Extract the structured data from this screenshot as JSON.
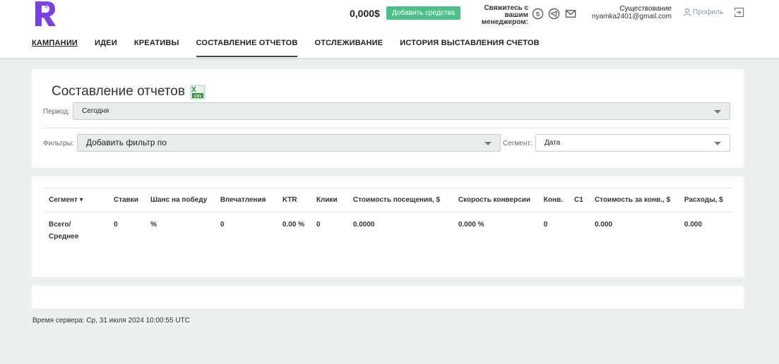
{
  "header": {
    "balance": "0,000$",
    "add_funds_label": "Добавить средства",
    "contact_label": "Свяжитесь с вашим менеджером:",
    "contact_icons": [
      "skype-icon",
      "telegram-icon",
      "mail-icon"
    ],
    "user_name": "Существование",
    "user_email": "nyamka2401@gmail.com",
    "profile_label": "Профиль"
  },
  "nav": {
    "items": [
      "КАМПАНИИ",
      "ИДЕИ",
      "КРЕАТИВЫ",
      "СОСТАВЛЕНИЕ ОТЧЕТОВ",
      "ОТСЛЕЖИВАНИЕ",
      "ИСТОРИЯ ВЫСТАВЛЕНИЯ СЧЕТОВ"
    ],
    "active": "СОСТАВЛЕНИЕ ОТЧЕТОВ",
    "underlined": "КАМПАНИИ"
  },
  "report": {
    "title": "Составление отчетов",
    "period_label": "Период:",
    "period_value": "Сегодня",
    "filters_label": "Фильтры:",
    "filters_value": "Добавить фильтр по",
    "segment_label": "Сегмент:",
    "segment_value": "Дата"
  },
  "table": {
    "headers": [
      "Сегмент ▾",
      "Ставки",
      "Шанс на победу",
      "Впечатления",
      "KTR",
      "Клики",
      "Стоимость посещения, $",
      "Скорость конверсии",
      "Конв.",
      "C1",
      "Стоимость за конв., $",
      "Расходы, $"
    ],
    "total_row": [
      "Всего/ Среднее",
      "0",
      "%",
      "0",
      "0.00 %",
      "0",
      "0.0000",
      "0.000 %",
      "0",
      "",
      "0.000",
      "0.000"
    ]
  },
  "footer": {
    "server_time": "Время сервера: Ср, 31 июля 2024 10:00:55 UTC"
  },
  "colors": {
    "accent_green": "#4cc08a",
    "logo_purple": "#7b3fe4",
    "background": "#edf0f0"
  }
}
